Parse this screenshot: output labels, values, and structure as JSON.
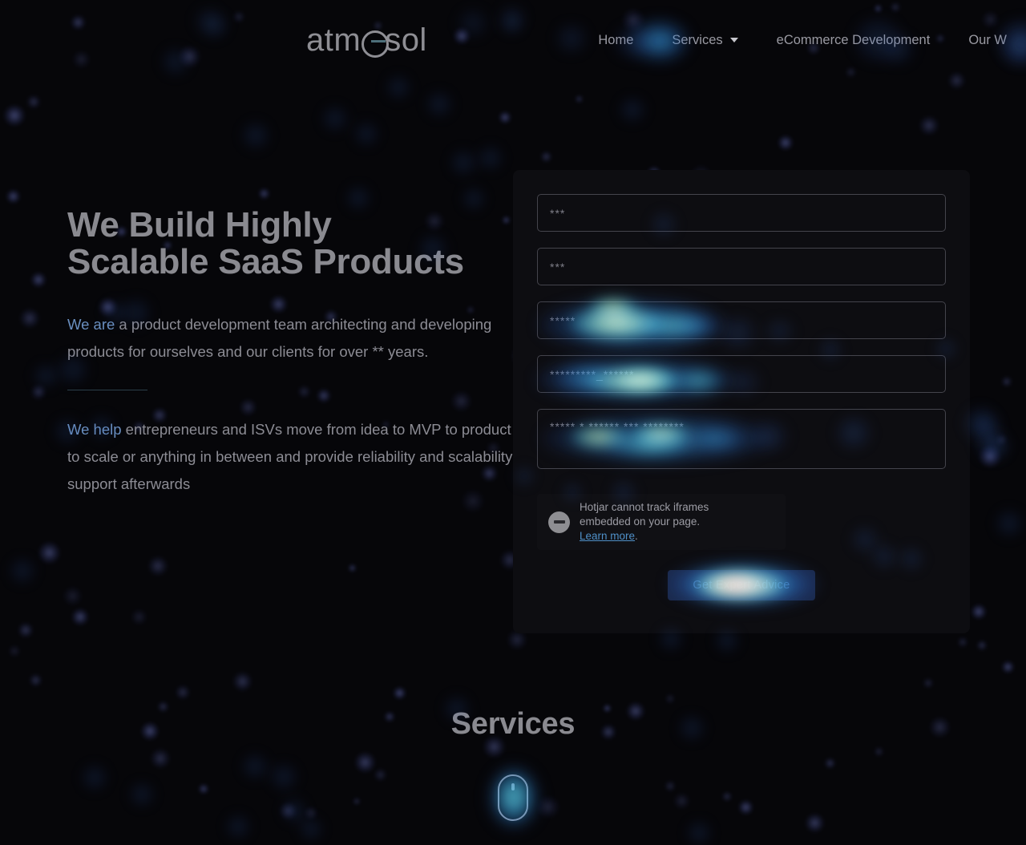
{
  "site": {
    "logo_text": "atmosol",
    "background_color": "#060609"
  },
  "header": {
    "nav_items": [
      {
        "label": "Home",
        "has_dropdown": false,
        "active": true
      },
      {
        "label": "Services",
        "has_dropdown": true,
        "active": false
      },
      {
        "label": "eCommerce Development",
        "has_dropdown": false,
        "active": false
      },
      {
        "label": "Our W",
        "has_dropdown": false,
        "active": false
      }
    ],
    "caret_icon": "chevron-down-icon"
  },
  "hero": {
    "heading_line1": "We Build Highly",
    "heading_line2": "Scalable SaaS Products",
    "paragraph1_accent": "We are",
    "paragraph1_rest": " a product development team architecting and developing products for ourselves and our clients for over ** years.",
    "paragraph2_accent": "We help",
    "paragraph2_rest": " entrepreneurs and ISVs move from idea to MVP to product to scale or anything in between and provide reliability and scalability support afterwards"
  },
  "form": {
    "fields": [
      {
        "name": "first-name-field",
        "value": "***",
        "type": "text"
      },
      {
        "name": "last-name-field",
        "value": "***",
        "type": "text"
      },
      {
        "name": "email-field",
        "value": "*****",
        "type": "text"
      },
      {
        "name": "phone-field",
        "value": "*********_******",
        "type": "text"
      },
      {
        "name": "message-field",
        "value": "***** * ****** *** ********",
        "type": "textarea"
      }
    ],
    "submit_label": "Get Expert Advice",
    "submit_bg": "#1b2a4d"
  },
  "hotjar_notice": {
    "icon": "no-entry-icon",
    "line1": "Hotjar cannot track iframes",
    "line2": "embedded on your page.",
    "link_label": "Learn more",
    "link_suffix": "."
  },
  "services": {
    "heading": "Services",
    "scroll_indicator": "scroll-mouse-icon"
  },
  "colors": {
    "accent_blue": "#6a8fc0",
    "text_muted": "#8c8c94",
    "heading": "#8a8a90",
    "link": "#4f90c8",
    "field_border": "#44444c"
  }
}
